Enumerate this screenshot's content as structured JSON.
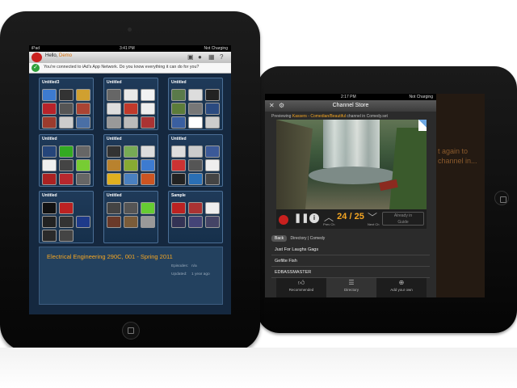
{
  "back_device": {
    "status_time": "2:17 PM",
    "status_right": "Not Charging",
    "title": "Channel Store",
    "icons": {
      "close": "close-icon",
      "settings": "gear-icon"
    },
    "now_playing": {
      "prefix": "Previewing",
      "channel": "Kassers - Comedian/Beautiful",
      "suffix": "channel in Comedy.set"
    },
    "counter": "24 / 25",
    "prev_label": "Prev Ch",
    "next_label": "Next Ch",
    "tv_button_line1": "Already in",
    "tv_button_line2": "Guide",
    "breadcrumb": {
      "back": "Back",
      "path1": "Directory",
      "sep": "|",
      "path2": "Comedy"
    },
    "list": [
      "Just For Laughs Gags",
      "Gefilte Fish",
      "EDBASSMASTER"
    ],
    "tabs": [
      {
        "label": "Recommended",
        "icon": "thumbs-up-icon"
      },
      {
        "label": "Directory",
        "icon": "list-icon"
      },
      {
        "label": "Add your own",
        "icon": "plus-icon"
      }
    ],
    "right_snippet_1": "t again to",
    "right_snippet_2": "channel in..."
  },
  "front_device": {
    "status_left": "iPad",
    "status_time": "3:41 PM",
    "status_right": "Not Charging",
    "hello_prefix": "Hello,",
    "hello_name": "Demo",
    "iad_notice": "You're connected to iAd's App Network. Do you know everything it can do for you?",
    "folders": [
      {
        "title": "Untitled3"
      },
      {
        "title": "Untitled"
      },
      {
        "title": "Untitled"
      },
      {
        "title": "Untitled"
      },
      {
        "title": "Untitled"
      },
      {
        "title": "Untitled"
      },
      {
        "title": "Untitled"
      },
      {
        "title": "Untitled"
      },
      {
        "title": "Sample"
      }
    ],
    "course_title": "Electrical Engineering 290C, 001 - Spring 2011",
    "episodes_label": "Episodes:",
    "episodes_value": "n/a",
    "updated_label": "Updated:",
    "updated_value": "1 year ago",
    "colors": {
      "accent": "#f5a623",
      "check": "#2fa03a"
    }
  }
}
